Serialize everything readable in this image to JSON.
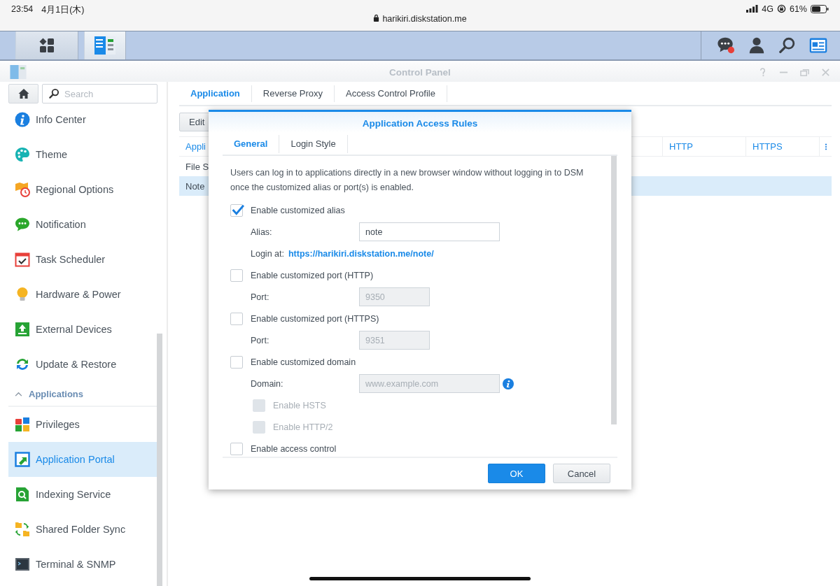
{
  "status_bar": {
    "time": "23:54",
    "date": "4月1日(木)",
    "url": "harikiri.diskstation.me",
    "network": "4G",
    "battery": "61%"
  },
  "taskbar": {
    "apps": [
      {
        "kind": "main-menu",
        "selected": false
      },
      {
        "kind": "control-panel",
        "selected": true
      }
    ],
    "notification_badge": true
  },
  "window": {
    "title": "Control Panel"
  },
  "sidebar": {
    "search": {
      "placeholder": "Search"
    },
    "items": [
      {
        "kind": "item",
        "label": "Info Center",
        "selected": false
      },
      {
        "kind": "item",
        "label": "Theme",
        "selected": false
      },
      {
        "kind": "item",
        "label": "Regional Options",
        "selected": false
      },
      {
        "kind": "item",
        "label": "Notification",
        "selected": false
      },
      {
        "kind": "item",
        "label": "Task Scheduler",
        "selected": false
      },
      {
        "kind": "item",
        "label": "Hardware & Power",
        "selected": false
      },
      {
        "kind": "item",
        "label": "External Devices",
        "selected": false
      },
      {
        "kind": "item",
        "label": "Update & Restore",
        "selected": false
      },
      {
        "kind": "section",
        "label": "Applications",
        "expanded": true
      },
      {
        "kind": "item",
        "label": "Privileges",
        "selected": false
      },
      {
        "kind": "item",
        "label": "Application Portal",
        "selected": true
      },
      {
        "kind": "item",
        "label": "Indexing Service",
        "selected": false
      },
      {
        "kind": "item",
        "label": "Shared Folder Sync",
        "selected": false
      },
      {
        "kind": "item",
        "label": "Terminal & SNMP",
        "selected": false
      }
    ]
  },
  "tabs": [
    {
      "label": "Application",
      "selected": true
    },
    {
      "label": "Reverse Proxy",
      "selected": false
    },
    {
      "label": "Access Control Profile",
      "selected": false
    }
  ],
  "toolbar": {
    "buttons": [
      "Edit"
    ]
  },
  "table": {
    "columns": [
      "Appli",
      "HTTP",
      "HTTPS"
    ],
    "rows": [
      {
        "cells": [
          "File S"
        ],
        "selected": false
      },
      {
        "cells": [
          "Note"
        ],
        "selected": true
      }
    ]
  },
  "dialog": {
    "title": "Application Access Rules",
    "tabs": [
      {
        "label": "General",
        "selected": true
      },
      {
        "label": "Login Style",
        "selected": false
      }
    ],
    "description": "Users can log in to applications directly in a new browser window without logging in to DSM once the customized alias or port(s) is enabled.",
    "options": [
      {
        "kind": "checkbox",
        "label": "Enable customized alias",
        "checked": true,
        "disabled": false
      },
      {
        "kind": "field",
        "label": "Alias:",
        "value": "note",
        "disabled": false
      },
      {
        "kind": "link",
        "label": "Login at:",
        "link": "https://harikiri.diskstation.me/note/"
      },
      {
        "kind": "checkbox",
        "label": "Enable customized port (HTTP)",
        "checked": false,
        "disabled": false
      },
      {
        "kind": "short-field",
        "label": "Port:",
        "value": "9350",
        "disabled": true
      },
      {
        "kind": "checkbox",
        "label": "Enable customized port (HTTPS)",
        "checked": false,
        "disabled": false
      },
      {
        "kind": "short-field",
        "label": "Port:",
        "value": "9351",
        "disabled": true
      },
      {
        "kind": "checkbox",
        "label": "Enable customized domain",
        "checked": false,
        "disabled": false
      },
      {
        "kind": "field",
        "label": "Domain:",
        "placeholder": "www.example.com",
        "disabled": true,
        "info": true
      },
      {
        "kind": "sub-checkbox",
        "label": "Enable HSTS",
        "checked": false,
        "disabled": true
      },
      {
        "kind": "sub-checkbox",
        "label": "Enable HTTP/2",
        "checked": false,
        "disabled": true
      },
      {
        "kind": "checkbox",
        "label": "Enable access control",
        "checked": false,
        "disabled": false
      }
    ],
    "buttons": [
      {
        "kind": "primary",
        "label": "OK"
      },
      {
        "kind": "secondary",
        "label": "Cancel"
      }
    ]
  }
}
